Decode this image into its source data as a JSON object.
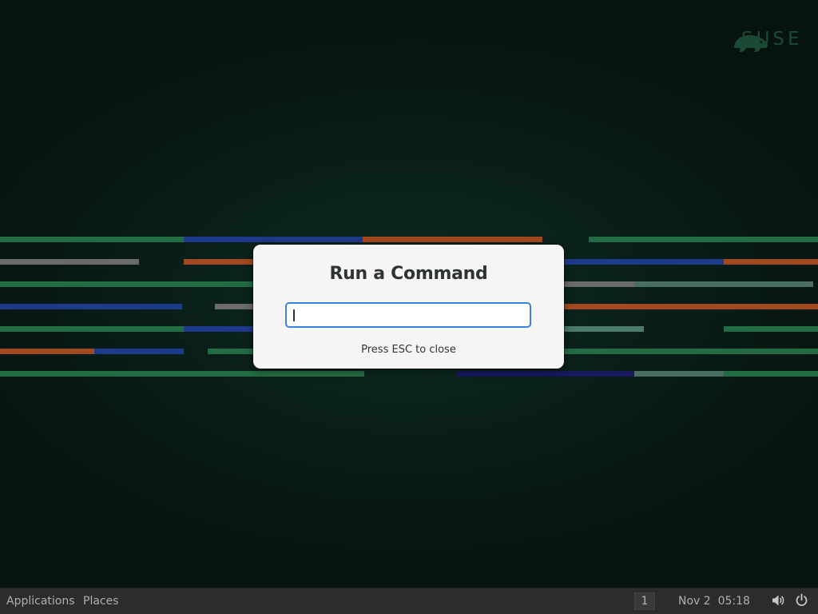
{
  "desktop": {
    "brand": "SUSE",
    "colors": {
      "green": "#2c7a4e",
      "blue": "#1e3a8a",
      "orange": "#a3491f",
      "gray": "#6b6b6b",
      "mint": "#4a8a6e",
      "navy": "#17185e"
    }
  },
  "run_dialog": {
    "title": "Run a Command",
    "input_value": "",
    "hint": "Press ESC to close"
  },
  "panel": {
    "applications_label": "Applications",
    "places_label": "Places",
    "workspace_number": "1",
    "clock": "Nov 2  05:18",
    "volume_icon": "speaker-volume-icon",
    "power_icon": "power-icon"
  }
}
